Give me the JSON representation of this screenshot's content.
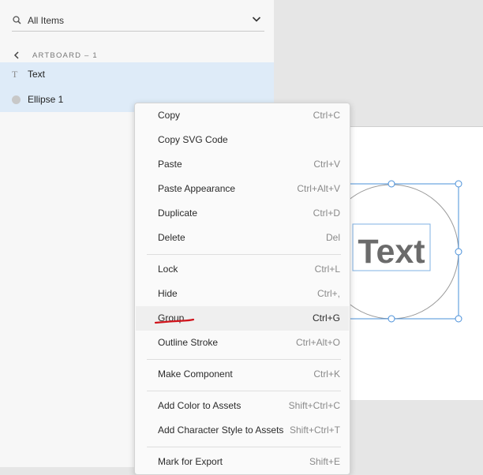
{
  "layers_panel": {
    "search_label": "All Items",
    "artboard_title": "ARTBOARD – 1",
    "layers": [
      {
        "label": "Text",
        "icon": "text-layer-icon"
      },
      {
        "label": "Ellipse 1",
        "icon": "ellipse-layer-icon"
      }
    ]
  },
  "canvas": {
    "text_object": "Text"
  },
  "context_menu": {
    "items": [
      {
        "label": "Copy",
        "shortcut": "Ctrl+C"
      },
      {
        "label": "Copy SVG Code",
        "shortcut": ""
      },
      {
        "label": "Paste",
        "shortcut": "Ctrl+V"
      },
      {
        "label": "Paste Appearance",
        "shortcut": "Ctrl+Alt+V"
      },
      {
        "label": "Duplicate",
        "shortcut": "Ctrl+D"
      },
      {
        "label": "Delete",
        "shortcut": "Del"
      },
      {
        "label": "Lock",
        "shortcut": "Ctrl+L"
      },
      {
        "label": "Hide",
        "shortcut": "Ctrl+,"
      },
      {
        "label": "Group",
        "shortcut": "Ctrl+G"
      },
      {
        "label": "Outline Stroke",
        "shortcut": "Ctrl+Alt+O"
      },
      {
        "label": "Make Component",
        "shortcut": "Ctrl+K"
      },
      {
        "label": "Add Color to Assets",
        "shortcut": "Shift+Ctrl+C"
      },
      {
        "label": "Add Character Style to Assets",
        "shortcut": "Shift+Ctrl+T"
      },
      {
        "label": "Mark for Export",
        "shortcut": "Shift+E"
      }
    ],
    "highlighted_item": "Group"
  },
  "colors": {
    "selection_blue": "#4a90d9",
    "layer_highlight": "#deebf8",
    "annotation_red": "#d0141c"
  }
}
